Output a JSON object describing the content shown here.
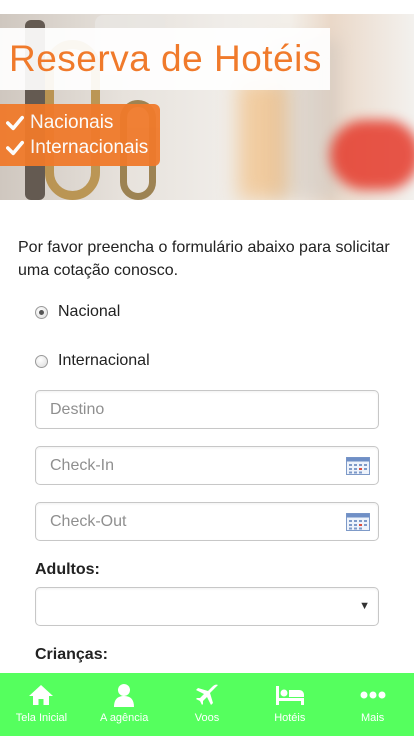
{
  "hero": {
    "title": "Reserva de Hotéis",
    "badges": [
      {
        "label": "Nacionais"
      },
      {
        "label": "Internacionais"
      }
    ],
    "accent_color": "#f07a2b"
  },
  "form": {
    "intro": "Por favor preencha o formulário abaixo para solicitar uma cotação conosco.",
    "radios": [
      {
        "label": "Nacional",
        "checked": true
      },
      {
        "label": "Internacional",
        "checked": false
      }
    ],
    "destino": {
      "placeholder": "Destino",
      "value": ""
    },
    "checkin": {
      "placeholder": "Check-In",
      "value": "",
      "icon": "calendar-icon"
    },
    "checkout": {
      "placeholder": "Check-Out",
      "value": "",
      "icon": "calendar-icon"
    },
    "adultos": {
      "label": "Adultos:",
      "selected": ""
    },
    "criancas": {
      "label": "Crianças:"
    }
  },
  "nav": {
    "background": "#55ff5e",
    "items": [
      {
        "label": "Tela Inicial",
        "icon": "home-icon"
      },
      {
        "label": "A agência",
        "icon": "user-icon"
      },
      {
        "label": "Voos",
        "icon": "plane-icon"
      },
      {
        "label": "Hotéis",
        "icon": "bed-icon"
      },
      {
        "label": "Mais",
        "icon": "more-icon"
      }
    ]
  }
}
